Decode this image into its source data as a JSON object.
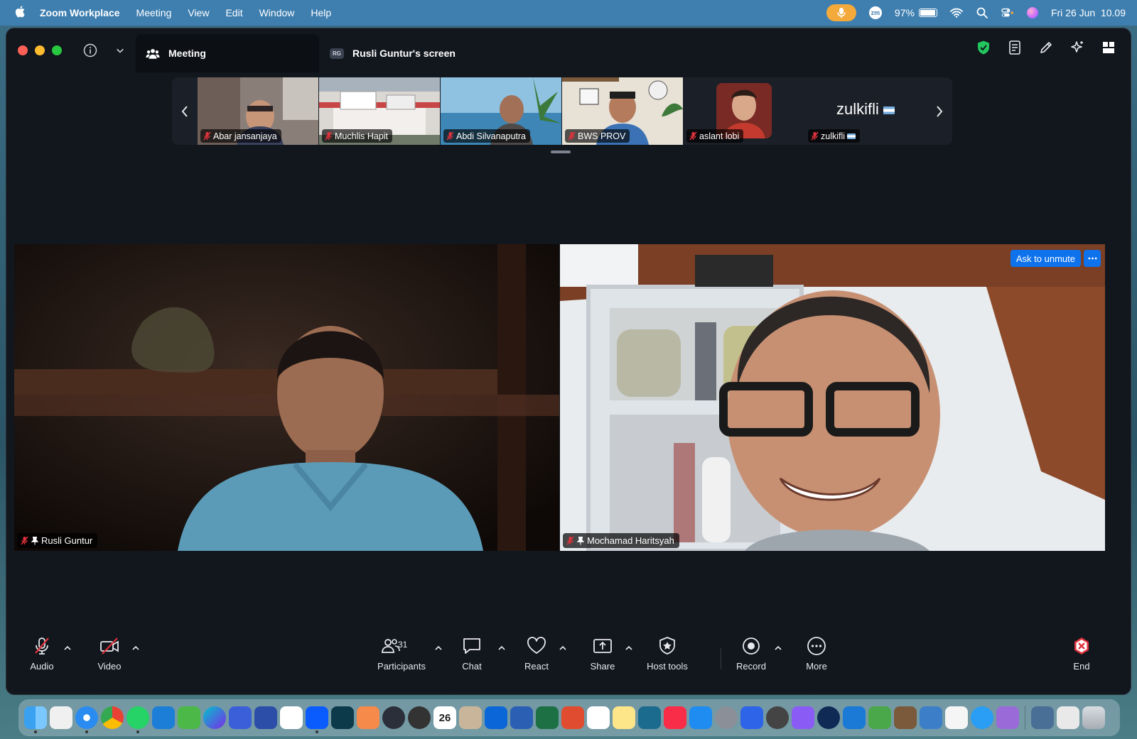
{
  "menubar": {
    "app_name": "Zoom Workplace",
    "menus": [
      "Meeting",
      "View",
      "Edit",
      "Window",
      "Help"
    ],
    "zm_badge": "zm",
    "battery": {
      "percent_label": "97%",
      "level": 0.97
    },
    "datetime": "Fri 26 Jun  10.09"
  },
  "window": {
    "tab_meeting_label": "Meeting",
    "tab_screen_badge": "RG",
    "tab_screen_label": "Rusli Guntur's screen"
  },
  "thumbnails": [
    {
      "name": "Abar jansanjaya",
      "bg": "#7d6f66"
    },
    {
      "name": "Muchlis Hapit",
      "bg": "#b98d8a"
    },
    {
      "name": "Abdi Silvanaputra",
      "bg": "#6a9cb8"
    },
    {
      "name": "BWS PROV",
      "bg": "#5d6f7a"
    },
    {
      "name": "aslant lobi",
      "bg": "#1b1f27"
    },
    {
      "name": "zulkifli",
      "display_name": "zulkifli",
      "bg": "#1b1f27"
    }
  ],
  "main_videos": [
    {
      "name": "Rusli Guntur"
    },
    {
      "name": "Mochamad Haritsyah",
      "ask_unmute_label": "Ask to unmute"
    }
  ],
  "toolbar": {
    "audio": "Audio",
    "video": "Video",
    "participants": "Participants",
    "participants_count": "31",
    "chat": "Chat",
    "react": "React",
    "share": "Share",
    "host_tools": "Host tools",
    "record": "Record",
    "more": "More",
    "end": "End"
  },
  "dock": {
    "calendar_day": "26"
  },
  "colors": {
    "zoom_blue": "#0e72ed",
    "end_red": "#e0323c",
    "muted_red": "#e0323c",
    "window_bg": "#12161d"
  }
}
